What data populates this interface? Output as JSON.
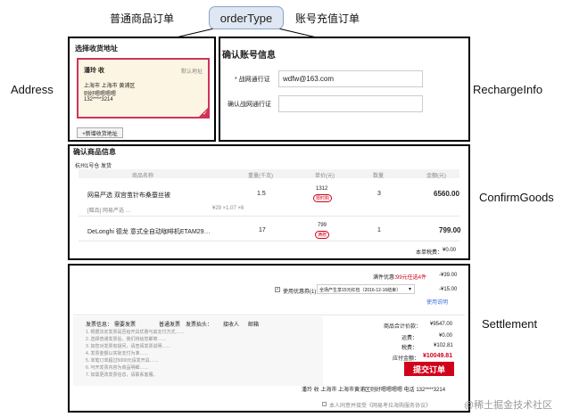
{
  "diagram": {
    "center_node": "orderType",
    "left_branch_label": "普通商品订单",
    "right_branch_label": "账号充值订单",
    "labels": {
      "address": "Address",
      "recharge_info": "RechargeInfo",
      "confirm_goods": "ConfirmGoods",
      "settlement": "Settlement"
    }
  },
  "address_panel": {
    "title": "选择收货地址",
    "card": {
      "name": "潘玲 收",
      "tag": "默认地址",
      "region": "上海市 上海市 黄浦区",
      "street": "则好嗯嗯嗯嗯",
      "phone": "132****3214"
    },
    "add_button": "+新增收货地址"
  },
  "recharge_panel": {
    "title": "确认账号信息",
    "account_label": "* 战网通行证",
    "account_value": "wdfw@163.com",
    "confirm_label": "确认战网通行证"
  },
  "goods_panel": {
    "title": "确认商品信息",
    "warehouse": "杭州1号仓 发货",
    "columns": [
      "商品名称",
      "重量(千克)",
      "单价(元)",
      "数量",
      "金额(元)"
    ],
    "rows": [
      {
        "name": "网易严选 双宫茧针布桑蚕丝被",
        "weight": "1.5",
        "price": "1312",
        "price_tag": "限时购",
        "qty": "3",
        "amount": "6560.00"
      },
      {
        "sub": "[赠品] 网易严选 …",
        "sub_extra": "¥29   ×1.07   ×6"
      },
      {
        "name": "DeLonghi 德龙 意式全自动咖啡机ETAM29…",
        "weight": "17",
        "price": "799",
        "price_tag": "满赠",
        "qty": "1",
        "amount": "799.00"
      }
    ],
    "tax_label": "本单税费：",
    "tax_value": "¥0.00"
  },
  "settlement_panel": {
    "promo_label": "满件优惠：",
    "promo_link": "99元任选4件",
    "promo_value": "-¥39.00",
    "coupon_checkbox_label": "使用优惠券(1)",
    "coupon_select": "全场产生享15元红包（2016-12-16结束）",
    "coupon_value": "-¥15.00",
    "coupon_link": "使用说明",
    "invoice_label": "发票信息：",
    "invoice_options": [
      "需要发票",
      "普通发票",
      "发票抬头：",
      "接收人",
      "邮箱"
    ],
    "notes": [
      "1. 根据法定发票是否给开具优惠与其支付方式……",
      "2. 选择普通发票后，我们将给您邮寄……",
      "3. 如您对发票有疑问，请查阅发票说明……",
      "4. 发票金额以实际支付为准……",
      "5. 单笔订单超过5000元请发开具……",
      "6. 可开发票内容为商品明细……",
      "7. 如需更改发票信息，请联系客服。"
    ],
    "summary": [
      {
        "label": "商品合计价款：",
        "value": "¥9547.00"
      },
      {
        "label": "运费：",
        "value": "¥0.00"
      },
      {
        "label": "税费：",
        "value": "¥102.81"
      },
      {
        "label": "应付金额：",
        "value": "¥10049.81"
      }
    ],
    "submit_button": "提交订单",
    "ship_to": "潘玲  收   上海市 上海市黄浦区则好嗯嗯嗯嗯   电话 132****3214",
    "agreement": "本人同意并接受《网易考拉海购服务协议》"
  },
  "watermark": "@稀土掘金技术社区"
}
